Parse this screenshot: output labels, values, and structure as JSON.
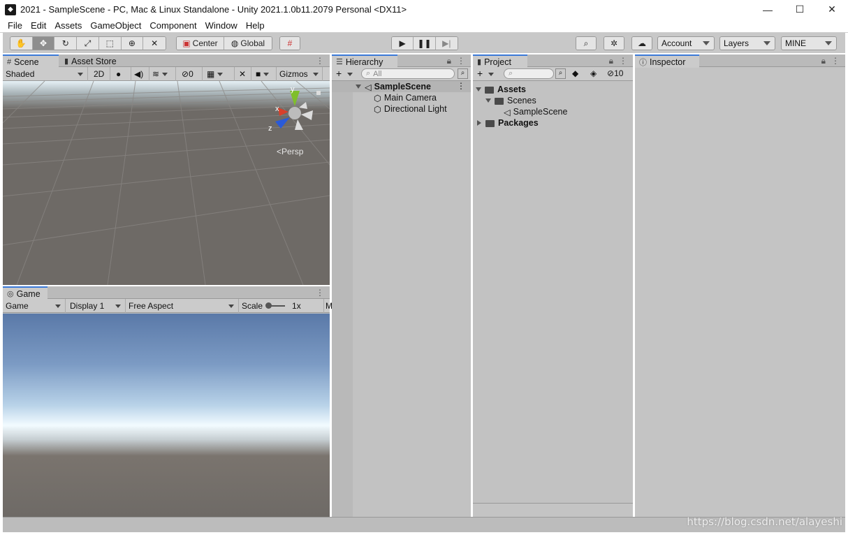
{
  "window": {
    "title": "2021 - SampleScene - PC, Mac & Linux Standalone - Unity 2021.1.0b11.2079 Personal <DX11>",
    "minimize": "—",
    "maximize": "☐",
    "close": "✕"
  },
  "menu": [
    "File",
    "Edit",
    "Assets",
    "GameObject",
    "Component",
    "Window",
    "Help"
  ],
  "toolbar": {
    "tools": [
      "hand-tool",
      "move-tool",
      "rotate-tool",
      "scale-tool",
      "rect-tool",
      "transform-tool",
      "custom-tool"
    ],
    "active_tool": "move-tool",
    "pivot_label": "Center",
    "space_label": "Global",
    "account_label": "Account",
    "layers_label": "Layers",
    "layout_label": "MINE"
  },
  "scene": {
    "tab_label": "Scene",
    "store_tab_label": "Asset Store",
    "draw_mode": "Shaded",
    "mode_2d": "2D",
    "hidden_count": "0",
    "gizmos_label": "Gizmos",
    "persp_label": "Persp",
    "axis_y": "y",
    "axis_x": "x",
    "axis_z": "z"
  },
  "game": {
    "tab_label": "Game",
    "mode_label": "Game",
    "display_label": "Display 1",
    "aspect_label": "Free Aspect",
    "scale_label": "Scale",
    "scale_value": "1x",
    "overflow_label": "M"
  },
  "hierarchy": {
    "tab_label": "Hierarchy",
    "search_placeholder": "All",
    "scene_name": "SampleScene",
    "items": [
      "Main Camera",
      "Directional Light"
    ]
  },
  "project": {
    "tab_label": "Project",
    "hidden_count": "10",
    "assets_label": "Assets",
    "scenes_label": "Scenes",
    "scene_file": "SampleScene",
    "packages_label": "Packages"
  },
  "inspector": {
    "tab_label": "Inspector"
  },
  "watermark": "https://blog.csdn.net/alayeshi",
  "colors": {
    "accent_tab": "#3a79d8",
    "panel_bg": "#c2c2c2",
    "scene_bg": "#6e6a66",
    "axis_y": "#7fbf2a",
    "axis_x": "#d8402a",
    "axis_z": "#2a5ad8"
  }
}
